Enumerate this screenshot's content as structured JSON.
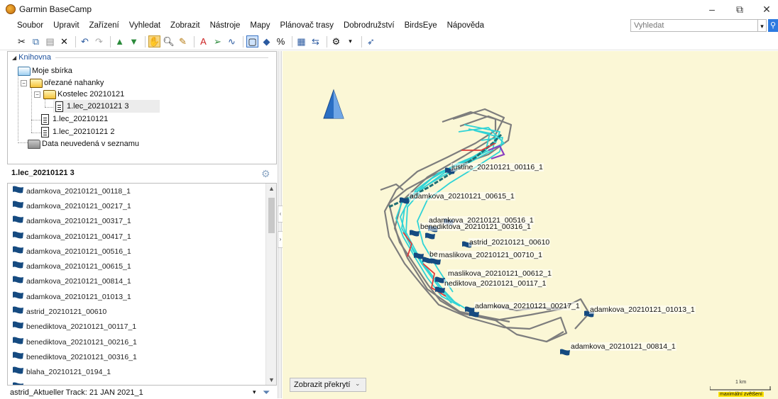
{
  "window": {
    "title": "Garmin BaseCamp",
    "controls": [
      "–",
      "⧉",
      "✕"
    ]
  },
  "menu": [
    "Soubor",
    "Upravit",
    "Zařízení",
    "Vyhledat",
    "Zobrazit",
    "Nástroje",
    "Mapy",
    "Plánovač trasy",
    "Dobrodružství",
    "BirdsEye",
    "Nápověda"
  ],
  "search": {
    "placeholder": "Vyhledat"
  },
  "toolbar_icons": [
    "cut-icon",
    "copy-icon",
    "paste-icon",
    "delete-icon",
    "undo-icon",
    "redo-icon",
    "receive-from-device-icon",
    "send-to-device-icon",
    "hand-tool-icon",
    "zoom-tool-icon",
    "measure-tool-icon",
    "new-waypoint-icon",
    "new-route-icon",
    "new-track-icon",
    "2d-view-icon",
    "3d-view-icon",
    "percent-icon",
    "grid-icon",
    "swap-icon",
    "filter-settings-icon",
    "rocket-icon"
  ],
  "library": {
    "header": "Knihovna",
    "items": [
      {
        "label": "Moje sbírka"
      },
      {
        "label": "ořezané nahanky"
      },
      {
        "label": "Kostelec 20210121"
      },
      {
        "label": "1.lec_20210121 3"
      },
      {
        "label": "1.lec_20210121"
      },
      {
        "label": "1.lec_20210121 2"
      },
      {
        "label": "Data neuvedená v seznamu"
      }
    ]
  },
  "list": {
    "title": "1.lec_20210121 3",
    "items": [
      "adamkova_20210121_00118_1",
      "adamkova_20210121_00217_1",
      "adamkova_20210121_00317_1",
      "adamkova_20210121_00417_1",
      "adamkova_20210121_00516_1",
      "adamkova_20210121_00615_1",
      "adamkova_20210121_00814_1",
      "adamkova_20210121_01013_1",
      "astrid_20210121_00610",
      "benediktova_20210121_00117_1",
      "benediktova_20210121_00216_1",
      "benediktova_20210121_00316_1",
      "blaha_20210121_0194_1",
      "..."
    ]
  },
  "status": {
    "text": "astrid_Aktueller Track: 21 JAN 2021_1"
  },
  "map": {
    "labels": [
      "justine_20210121_00116_1",
      "adamkova_20210121_00615_1",
      "adamkova_20210121_00516_1",
      "benediktova_20210121_00316_1",
      "astrid_20210121_00610",
      "be",
      "maslikova_20210121_00710_1",
      "maslikova_20210121_00612_1",
      "nediktova_20210121_00117_1",
      "adamkova_20210121_00217_1",
      "adamkova_20210121_01013_1",
      "adamkova_20210121_00814_1"
    ],
    "overlay_button": "Zobrazit překrytí",
    "scale_label": "1 km",
    "scale_note": "maximální zvětšení",
    "colors": {
      "background": "#fbf7d6",
      "track_grey": "#7d7d7d",
      "track_cyan": "#2fd3d6",
      "track_red": "#e03a3a",
      "track_purple": "#8a3fc0",
      "flag": "#154a80",
      "north": "#2a6fc4"
    }
  }
}
